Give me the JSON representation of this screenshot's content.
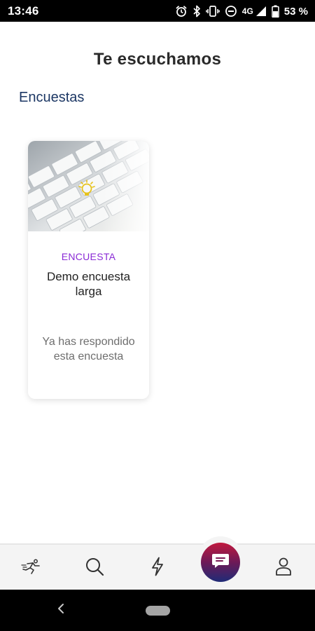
{
  "status_bar": {
    "time": "13:46",
    "network": "4G",
    "battery": "53 %",
    "icons": [
      "alarm-icon",
      "bluetooth-icon",
      "vibrate-icon",
      "do-not-disturb-icon",
      "signal-icon",
      "battery-icon"
    ]
  },
  "header": {
    "title": "Te escuchamos"
  },
  "section": {
    "title": "Encuestas"
  },
  "surveys": [
    {
      "category": "ENCUESTA",
      "title": "Demo encuesta larga",
      "status": "Ya has respondido esta encuesta",
      "image_icon": "keyboard-lightbulb-image"
    }
  ],
  "bottom_nav": {
    "items": [
      {
        "icon": "runner-icon"
      },
      {
        "icon": "search-icon"
      },
      {
        "icon": "lightning-icon"
      },
      {
        "icon": "chat-icon",
        "active": true
      },
      {
        "icon": "profile-icon"
      }
    ],
    "accent_gradient": [
      "#c0193e",
      "#1f2b77"
    ]
  },
  "colors": {
    "section_title": "#1c3764",
    "category": "#8a2ad6",
    "status_text": "#6e6e6e"
  }
}
